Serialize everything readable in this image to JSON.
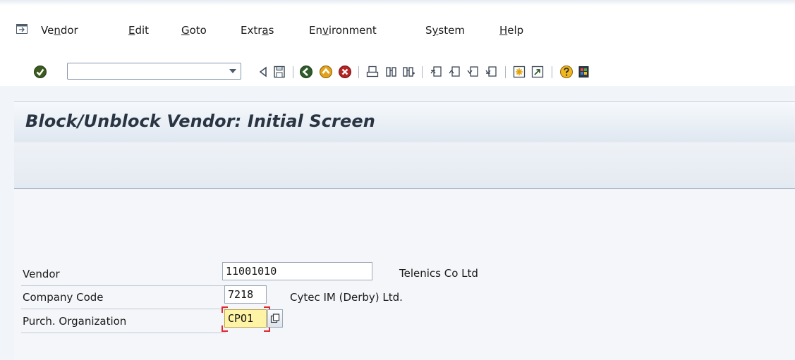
{
  "menu": {
    "items": [
      {
        "pre": "Ve",
        "ul": "n",
        "post": "dor"
      },
      {
        "pre": "",
        "ul": "E",
        "post": "dit"
      },
      {
        "pre": "",
        "ul": "G",
        "post": "oto"
      },
      {
        "pre": "Extr",
        "ul": "a",
        "post": "s"
      },
      {
        "pre": "En",
        "ul": "v",
        "post": "ironment"
      },
      {
        "pre": "S",
        "ul": "y",
        "post": "stem"
      },
      {
        "pre": "",
        "ul": "H",
        "post": "elp"
      }
    ]
  },
  "toolbar": {
    "command_field_value": "",
    "icons": [
      "enter-icon",
      "back-arrow-icon",
      "save-icon",
      "back-icon",
      "exit-icon",
      "cancel-icon",
      "print-icon",
      "find-icon",
      "find-next-icon",
      "first-page-icon",
      "previous-page-icon",
      "next-page-icon",
      "last-page-icon",
      "new-session-icon",
      "shortcut-icon",
      "help-icon",
      "customize-layout-icon"
    ]
  },
  "title": "Block/Unblock Vendor:  Initial Screen",
  "form": {
    "vendor": {
      "label": "Vendor",
      "value": "11001010",
      "description": "Telenics Co Ltd"
    },
    "company_code": {
      "label": "Company Code",
      "value": "7218",
      "description": "Cytec IM (Derby) Ltd."
    },
    "purch_org": {
      "label": "Purch. Organization",
      "value": "CPO1"
    }
  },
  "colors": {
    "title_bg": "#dfe7f0",
    "focused_field": "#fff3a6",
    "focus_corner": "#e0282e"
  }
}
